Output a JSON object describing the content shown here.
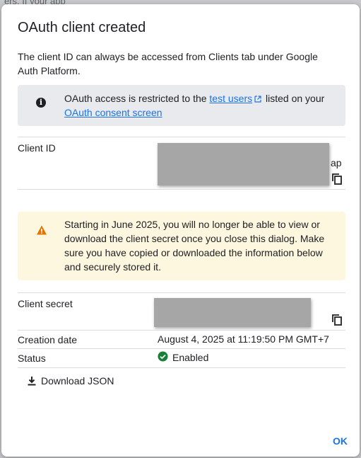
{
  "background": {
    "text": "ers. If your app"
  },
  "dialog": {
    "title": "OAuth client created",
    "description": "The client ID can always be accessed from Clients tab under Google Auth Platform.",
    "info": {
      "text_before": "OAuth access is restricted to the ",
      "test_users_link": "test users",
      "text_middle": " listed on your ",
      "consent_link": "OAuth consent screen"
    },
    "client_id": {
      "label": "Client ID",
      "value_suffix": "ap"
    },
    "warning": {
      "text": "Starting in June 2025, you will no longer be able to view or download the client secret once you close this dialog. Make sure you have copied or downloaded the information below and securely stored it."
    },
    "client_secret": {
      "label": "Client secret"
    },
    "creation_date": {
      "label": "Creation date",
      "value": "August 4, 2025 at 11:19:50 PM GMT+7"
    },
    "status": {
      "label": "Status",
      "value": "Enabled"
    },
    "download_label": "Download JSON",
    "ok_label": "OK"
  },
  "colors": {
    "link": "#1a73e8",
    "info_bg": "#e8eaed",
    "warning_bg": "#fef7e0",
    "warning_icon": "#e37400",
    "status_ok": "#188038",
    "redaction": "#a6a6a6"
  },
  "icons": {
    "info": "info-icon",
    "external_link": "external-link-icon",
    "copy": "copy-icon",
    "warning": "warning-icon",
    "status": "check-circle-icon",
    "download": "download-icon"
  }
}
